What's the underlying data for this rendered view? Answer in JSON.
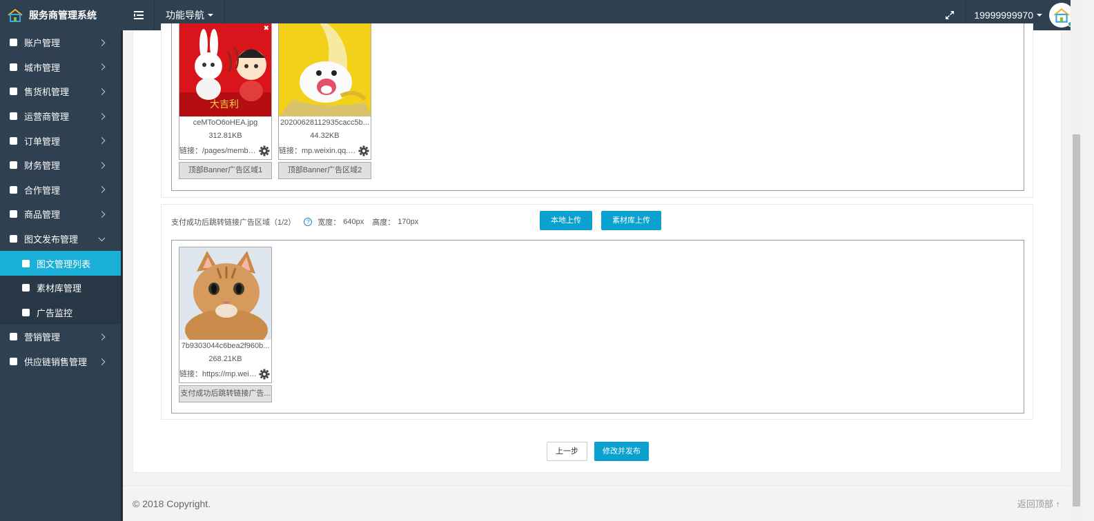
{
  "app": {
    "title": "服务商管理系统"
  },
  "topbar": {
    "nav_label": "功能导航",
    "user_name": "19999999970"
  },
  "sidebar": {
    "items": [
      {
        "label": "账户管理"
      },
      {
        "label": "城市管理"
      },
      {
        "label": "售货机管理"
      },
      {
        "label": "运营商管理"
      },
      {
        "label": "订单管理"
      },
      {
        "label": "财务管理"
      },
      {
        "label": "合作管理"
      },
      {
        "label": "商品管理"
      },
      {
        "label": "图文发布管理"
      }
    ],
    "subitems": [
      {
        "label": "图文管理列表"
      },
      {
        "label": "素材库管理"
      },
      {
        "label": "广告监控"
      }
    ],
    "items_after": [
      {
        "label": "营销管理"
      },
      {
        "label": "供应链销售管理"
      }
    ]
  },
  "banner_section": {
    "cards": [
      {
        "filename": "ceMToO6oHEA.jpg",
        "size": "312.81KB",
        "link": "链接：/pages/membership",
        "area": "顶部Banner广告区域1"
      },
      {
        "filename": "20200628112935cacc5b...",
        "size": "44.32KB",
        "link": "链接：mp.weixin.qq.com",
        "area": "顶部Banner广告区域2"
      }
    ]
  },
  "pay_section": {
    "title": "支付成功后跳转链接广告区域（1/2）",
    "width_label": "宽度：",
    "width_value": "640px",
    "height_label": "高度：",
    "height_value": "170px",
    "local_upload": "本地上传",
    "library_upload": "素材库上传",
    "cards": [
      {
        "filename": "7b9303044c6bea2f960b...",
        "size": "268.21KB",
        "link": "链接：https://mp.weixin.qq.com",
        "area": "支付成功后跳转链接广告..."
      }
    ]
  },
  "actions": {
    "prev": "上一步",
    "publish": "修改并发布"
  },
  "footer": {
    "copyright": "© 2018 Copyright.",
    "back_top": "返回顶部"
  },
  "colors": {
    "sidebar_bg": "#2f4050",
    "active_item": "#1ab0d8",
    "primary_button": "#0aa0d0"
  }
}
